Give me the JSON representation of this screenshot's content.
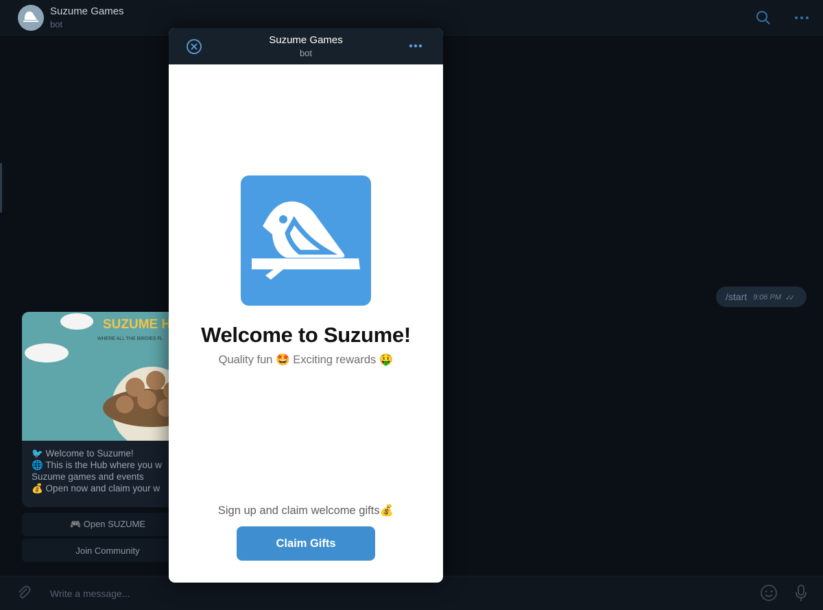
{
  "chat": {
    "title": "Suzume Games",
    "subtitle": "bot",
    "outgoing": {
      "text": "/start",
      "time": "9:06 PM",
      "status_icon": "double-check-icon"
    },
    "message": {
      "image_title": "SUZUME HUB",
      "image_subtitle": "WHERE ALL THE BIRDIES FL",
      "lines": [
        "🐦 Welcome to Suzume!",
        "🌐 This is the Hub where you w",
        "Suzume games and events",
        "💰 Open now and claim your w"
      ]
    },
    "keyboard": [
      "🎮 Open SUZUME",
      "Join Community"
    ],
    "composer": {
      "placeholder": "Write a message..."
    },
    "icons": [
      "search-icon",
      "more-icon",
      "attach-icon",
      "emoji-icon",
      "mic-icon"
    ]
  },
  "miniapp": {
    "title": "Suzume Games",
    "subtitle": "bot",
    "welcome": "Welcome to Suzume!",
    "tagline": "Quality fun 🤩 Exciting rewards 🤑",
    "signup_text": "Sign up and claim welcome gifts💰",
    "claim_button": "Claim Gifts",
    "colors": {
      "accent": "#4a9de2",
      "button": "#3f8fd0",
      "header": "#17212b"
    }
  }
}
